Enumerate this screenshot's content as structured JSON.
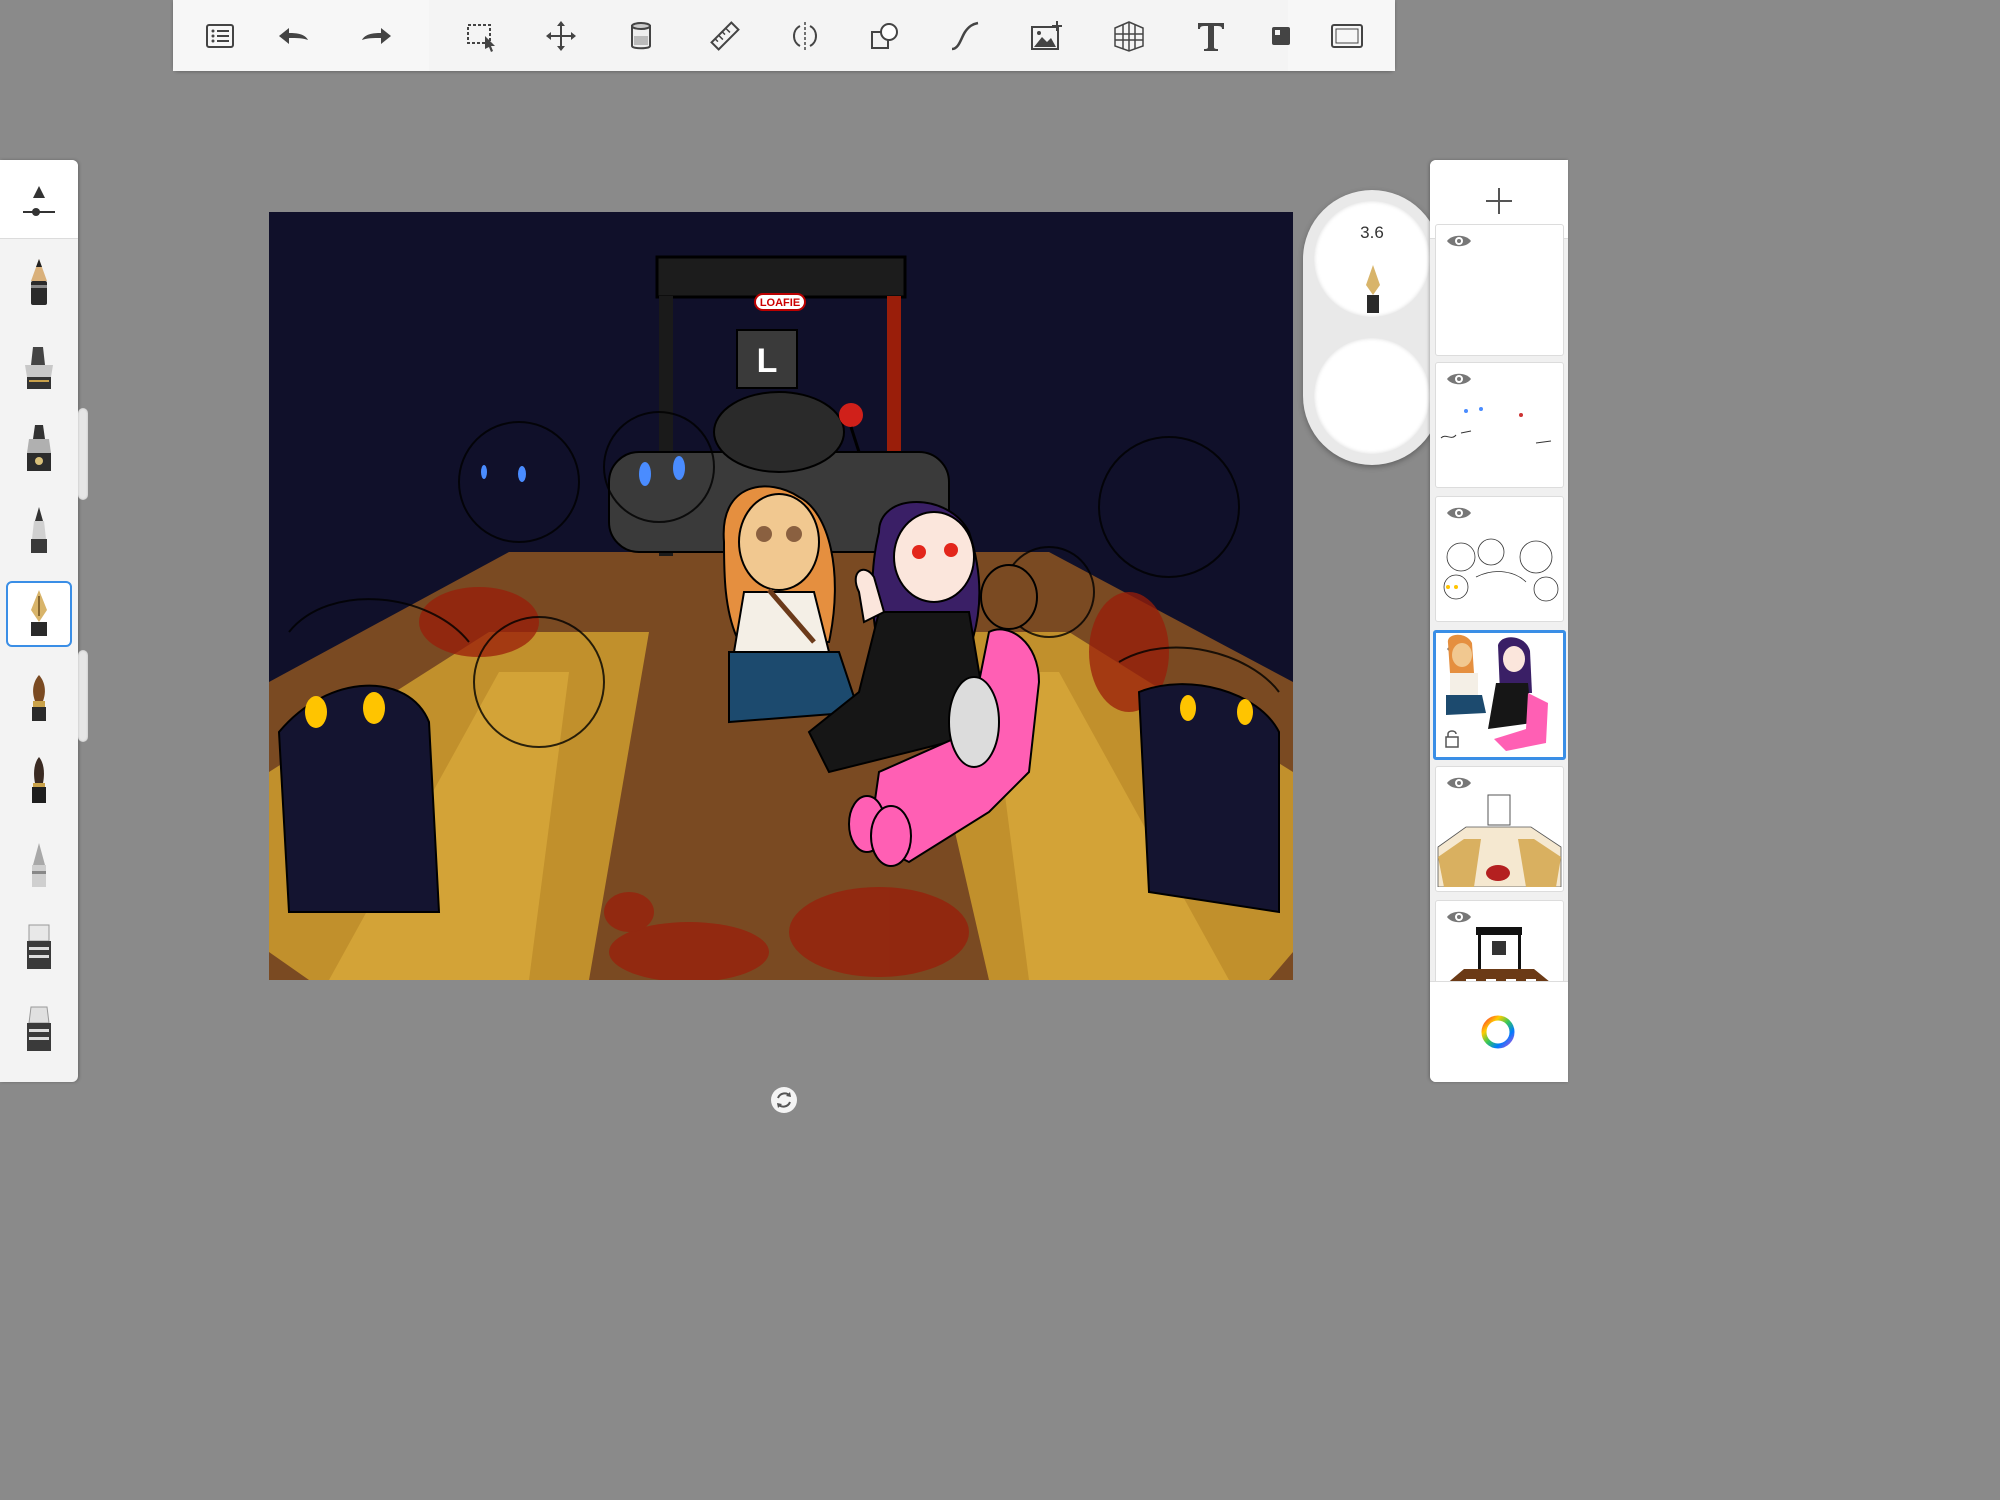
{
  "toolbar": {
    "icons": [
      "list-icon",
      "undo-icon",
      "redo-icon",
      "selection-icon",
      "transform-icon",
      "fill-icon",
      "ruler-icon",
      "symmetry-icon",
      "shape-icon",
      "curve-icon",
      "image-add-icon",
      "perspective-icon",
      "text-icon",
      "layer-stack-icon",
      "fullscreen-icon"
    ]
  },
  "brushes": {
    "items": [
      "pencil",
      "marker",
      "paint-pen",
      "fine-liner",
      "ink-pen",
      "paintbrush",
      "chisel-brush",
      "airbrush",
      "eraser",
      "smudge"
    ],
    "selected_index": 4
  },
  "puck": {
    "size_value": "3.6",
    "opacity_value": ""
  },
  "canvas": {
    "sign_text": "LOAFIE",
    "box_letter": "L",
    "colors": {
      "background": "#10102a",
      "floor": "#7a4a22",
      "bench": "#c9982e",
      "blood": "#9a1e0a",
      "pink": "#ff5fb4",
      "hair_orange": "#e58f3f",
      "hair_purple": "#3a1f66",
      "skirt": "#1c4a6e",
      "eyes_yellow": "#ffc400",
      "eyes_blue": "#4a8cff",
      "eyes_red": "#e3261b"
    }
  },
  "layers": {
    "count": 6,
    "selected_index": 3
  }
}
